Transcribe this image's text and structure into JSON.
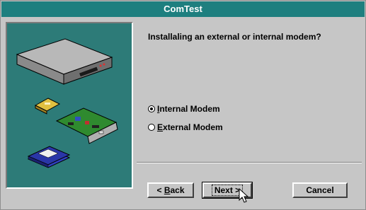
{
  "window": {
    "title": "ComTest"
  },
  "prompt": {
    "question": "Installaling an external or internal modem?"
  },
  "options": [
    {
      "accel": "I",
      "rest": "nternal Modem",
      "selected": true
    },
    {
      "accel": "E",
      "rest": "xternal Modem",
      "selected": false
    }
  ],
  "buttons": {
    "back": {
      "prefix": "< ",
      "accel": "B",
      "rest": "ack"
    },
    "next": {
      "label": "Next >"
    },
    "cancel": {
      "label": "Cancel"
    }
  },
  "colors": {
    "title_bar": "#1e7f7f",
    "art_panel": "#2d7b78",
    "dialog_face": "#c6c6c6"
  },
  "icons": [
    "external-modem-icon",
    "pcmcia-card-icon",
    "internal-modem-card-icon",
    "floppy-disks-icon",
    "mouse-cursor-icon"
  ]
}
